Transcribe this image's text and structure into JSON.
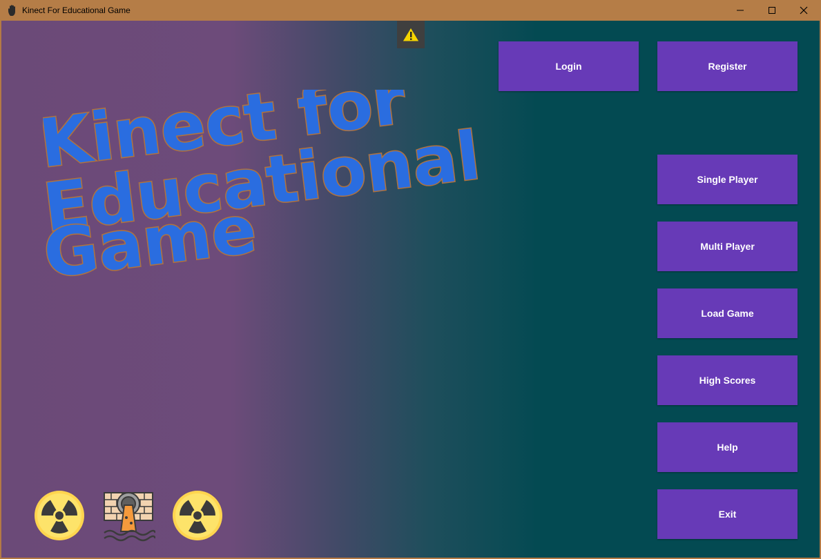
{
  "window": {
    "title": "Kinect For Educational Game",
    "app_icon": "hand-icon",
    "controls": [
      "minimize-icon",
      "maximize-icon",
      "close-icon"
    ]
  },
  "status": {
    "warning_icon": "warning-icon"
  },
  "logo": {
    "lines": [
      "Kinect for",
      "Educational",
      "Game"
    ]
  },
  "auth": {
    "login_label": "Login",
    "register_label": "Register"
  },
  "menu": {
    "single_player": "Single Player",
    "multi_player": "Multi Player",
    "load_game": "Load Game",
    "high_scores": "High Scores",
    "help": "Help",
    "exit": "Exit"
  },
  "bottom_icons": [
    "radiation-icon",
    "sewage-pipe-icon",
    "radiation-icon"
  ],
  "colors": {
    "button_bg": "#673ab7",
    "button_text": "#ffffff",
    "logo_fill": "#2a6de0",
    "logo_stroke": "#b2733c",
    "titlebar": "#b57d47",
    "bg_left": "#6d4b7a",
    "bg_right": "#034a52"
  }
}
